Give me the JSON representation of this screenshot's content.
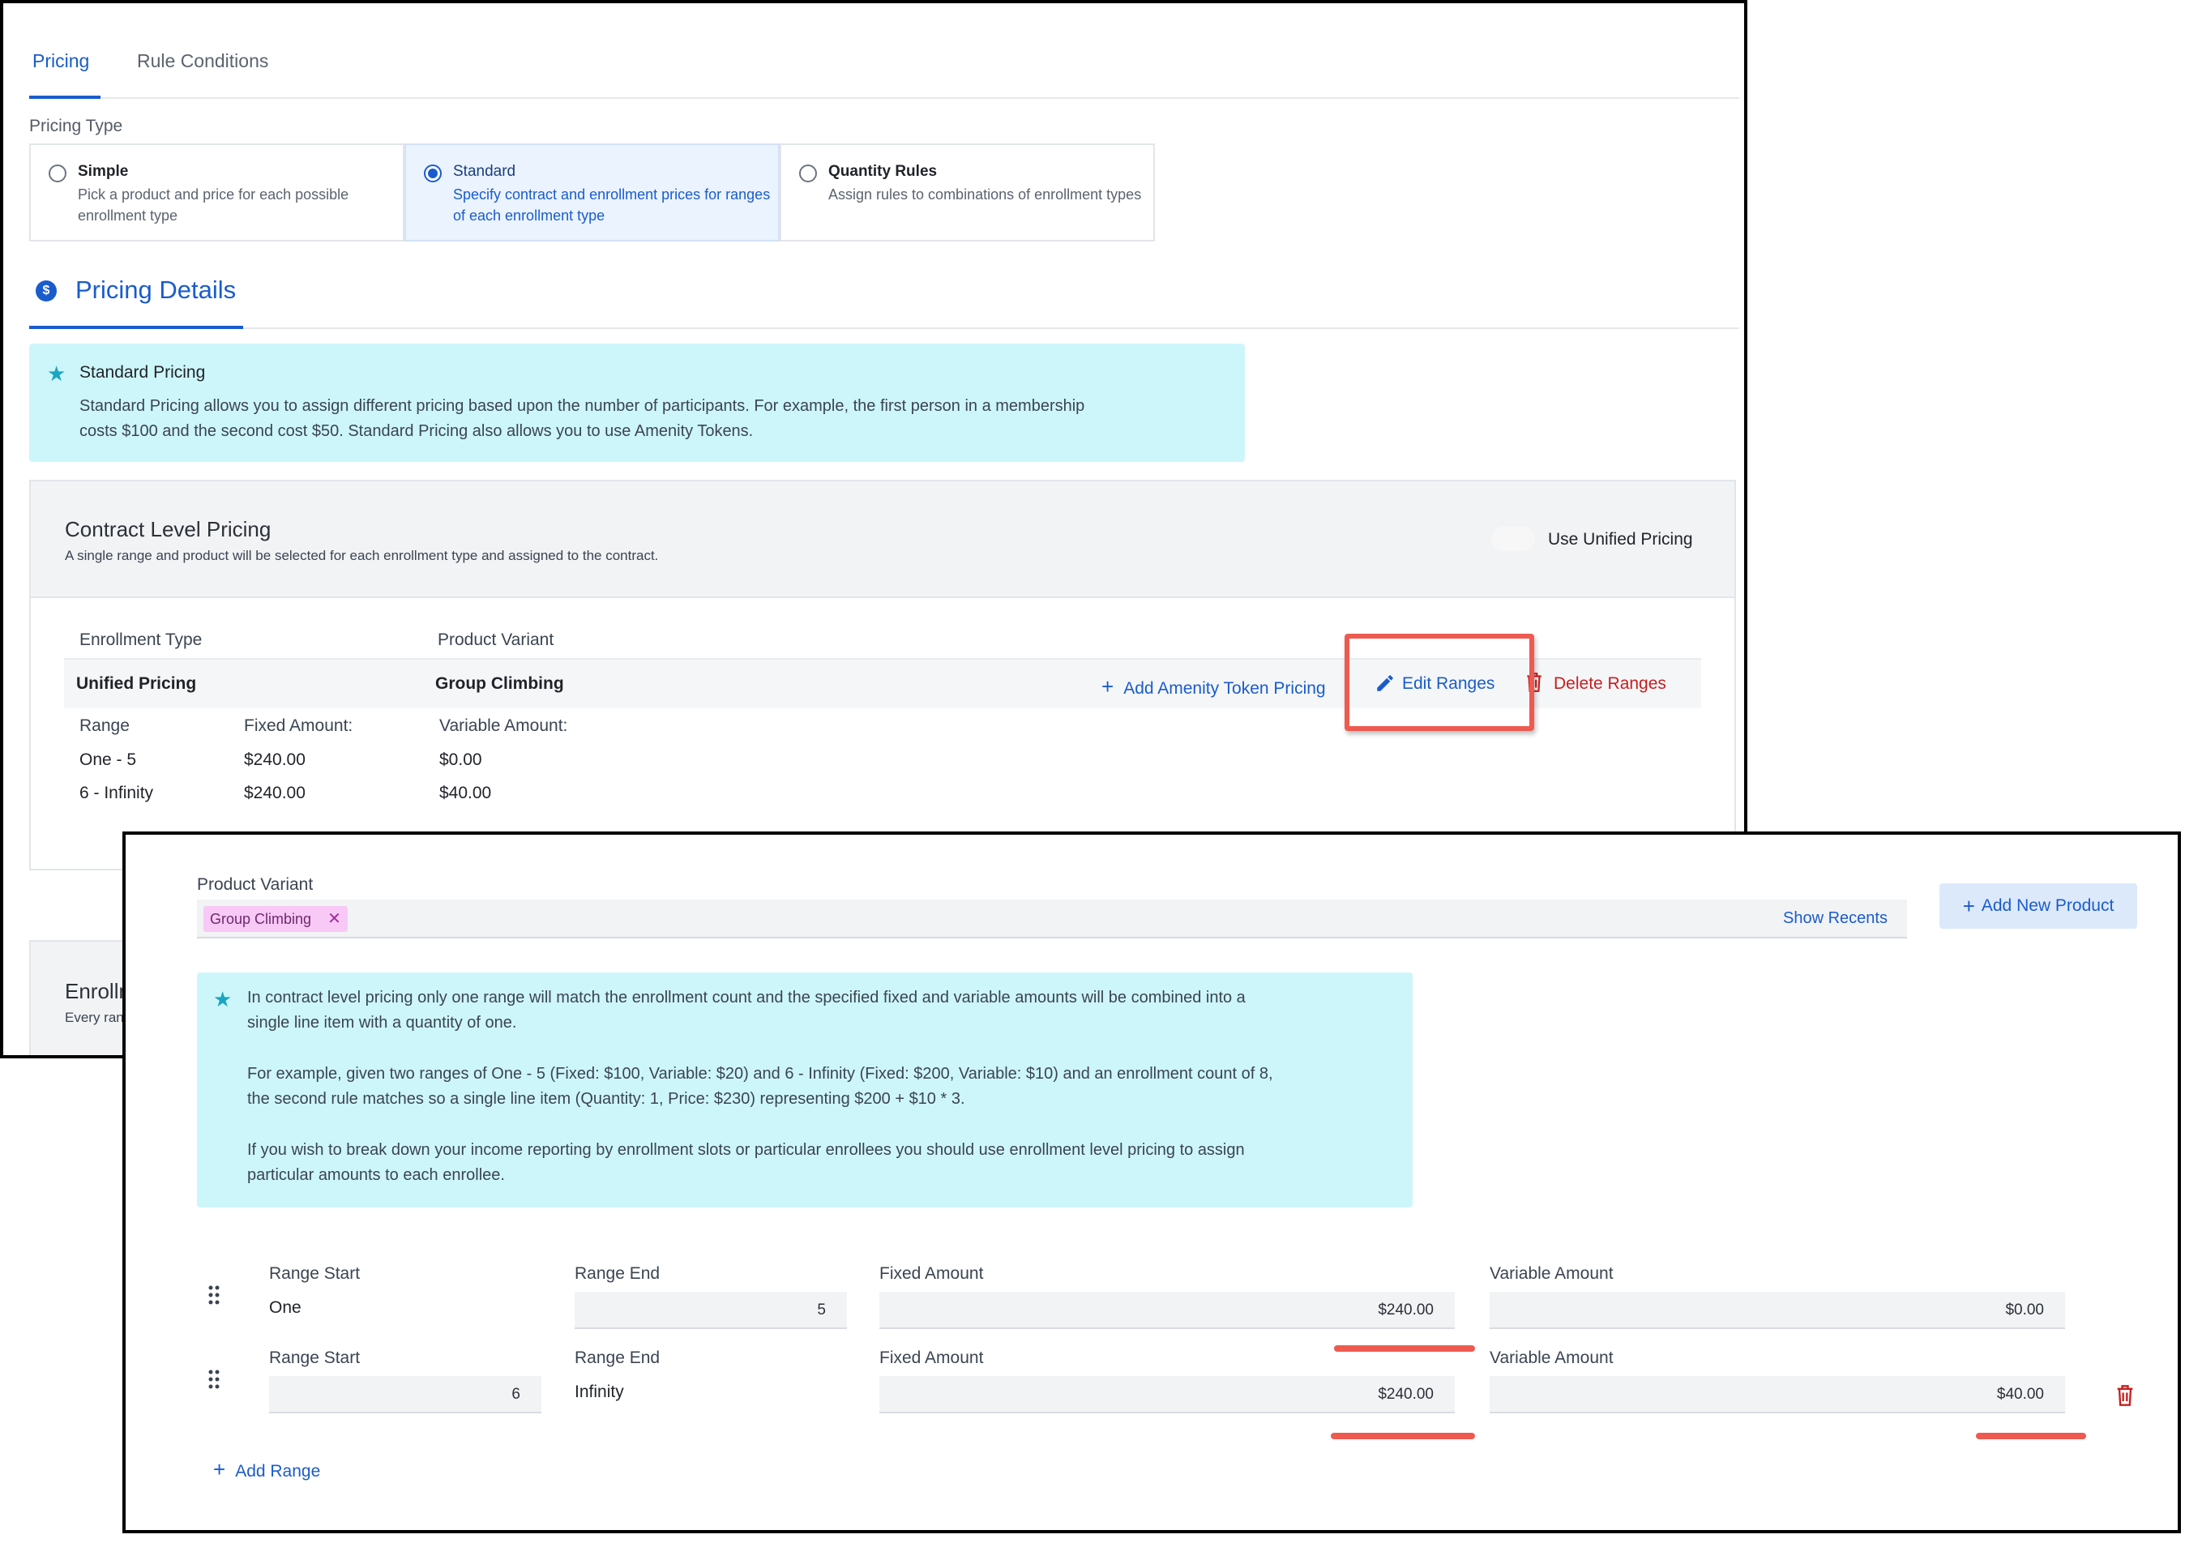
{
  "tabs": [
    {
      "label": "Pricing",
      "active": true
    },
    {
      "label": "Rule Conditions",
      "active": false
    }
  ],
  "pricing_type": {
    "label": "Pricing Type",
    "options": [
      {
        "title": "Simple",
        "desc": "Pick a product and price for each possible enrollment type",
        "selected": false
      },
      {
        "title": "Standard",
        "desc": "Specify contract and enrollment prices for ranges of each enrollment type",
        "selected": true
      },
      {
        "title": "Quantity Rules",
        "desc": "Assign rules to combinations of enrollment types",
        "selected": false
      }
    ]
  },
  "pricing_details": {
    "icon": "dollar-icon",
    "icon_glyph": "$",
    "title": "Pricing Details",
    "info": {
      "icon": "star-icon",
      "title": "Standard Pricing",
      "line1": "Standard Pricing allows you to assign different pricing based upon the number of participants. For example, the first person in a membership",
      "line2": "costs $100 and the second cost $50. Standard Pricing also allows you to use Amenity Tokens."
    }
  },
  "contract": {
    "title": "Contract Level Pricing",
    "subtitle": "A single range and product will be selected for each enrollment type and assigned to the contract.",
    "toggle_label": "Use Unified Pricing",
    "toggle_on": false,
    "col_enrollment_type": "Enrollment Type",
    "col_product_variant": "Product Variant",
    "row": {
      "enrollment_type": "Unified Pricing",
      "product_variant": "Group Climbing",
      "add_token": "Add Amenity Token Pricing",
      "edit_ranges": "Edit Ranges",
      "delete_ranges": "Delete Ranges"
    },
    "range_headers": {
      "range": "Range",
      "fixed": "Fixed Amount:",
      "variable": "Variable Amount:"
    },
    "ranges": [
      {
        "range": "One - 5",
        "fixed": "$240.00",
        "variable": "$0.00"
      },
      {
        "range": "6 - Infinity",
        "fixed": "$240.00",
        "variable": "$40.00"
      }
    ]
  },
  "enrollment_section": {
    "title": "Enrollment Level Pricing",
    "subtitle": "Every range"
  },
  "editor": {
    "product_variant_label": "Product Variant",
    "tag": "Group Climbing",
    "tag_remove": "✕",
    "show_recents": "Show Recents",
    "add_new_product": "Add New Product",
    "info": {
      "icon": "star-icon",
      "p1_l1": "In contract level pricing only one range will match the enrollment count and the specified fixed and variable amounts will be combined into a",
      "p1_l2": "single line item with a quantity of one.",
      "p2_l1": "For example, given two ranges of One - 5 (Fixed: $100, Variable: $20) and 6 - Infinity (Fixed: $200, Variable: $10) and an enrollment count of 8,",
      "p2_l2": "the second rule matches so a single line item (Quantity: 1, Price: $230) representing $200 + $10 * 3.",
      "p3_l1": "If you wish to break down your income reporting by enrollment slots or particular enrollees you should use enrollment level pricing to assign",
      "p3_l2": "particular amounts to each enrollee."
    },
    "labels": {
      "range_start": "Range Start",
      "range_end": "Range End",
      "fixed": "Fixed Amount",
      "variable": "Variable Amount"
    },
    "ranges": [
      {
        "start": "One",
        "end": "5",
        "fixed": "$240.00",
        "variable": "$0.00"
      },
      {
        "start": "6",
        "end": "Infinity",
        "fixed": "$240.00",
        "variable": "$40.00"
      }
    ],
    "add_range": "Add Range"
  },
  "colors": {
    "accent": "#1a5ccc",
    "danger": "#c81e1e",
    "annotation": "#ee5a50",
    "info_bg": "#cdf6fa"
  }
}
